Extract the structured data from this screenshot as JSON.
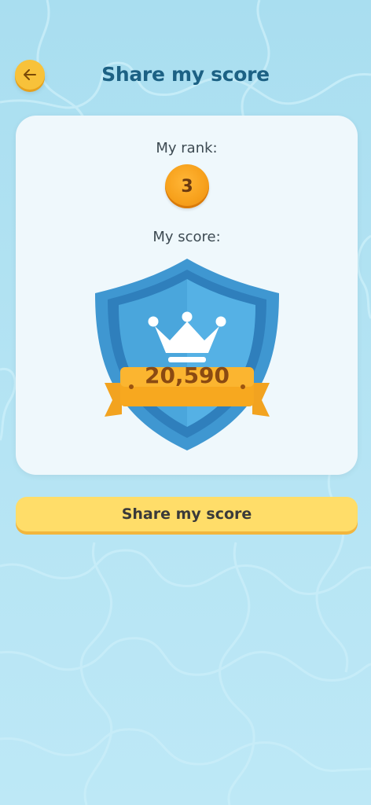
{
  "header": {
    "title": "Share my score",
    "back_icon": "arrow-left-icon"
  },
  "card": {
    "rank_label": "My rank:",
    "rank": "3",
    "score_label": "My score:",
    "score": "20,590",
    "badge_icon": "shield-crown-icon"
  },
  "actions": {
    "share_label": "Share my score"
  },
  "colors": {
    "background": "#b3e3f3",
    "title": "#1c6184",
    "accent_yellow": "#f8c23a",
    "accent_orange": "#f7a11c",
    "shield_blue": "#4aa6dc",
    "button_yellow": "#ffdd69"
  }
}
